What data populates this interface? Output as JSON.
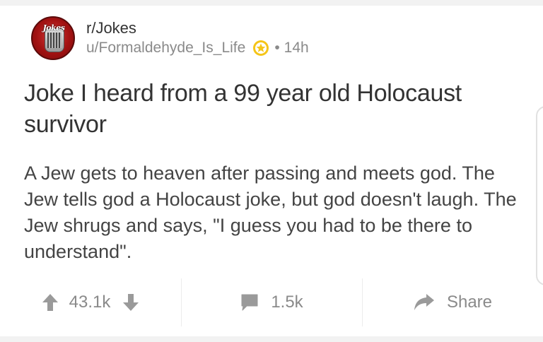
{
  "post": {
    "subreddit": "r/Jokes",
    "username": "u/Formaldehyde_Is_Life",
    "separator": "•",
    "age": "14h",
    "title": "Joke I heard from a 99 year old Holocaust survivor",
    "body": "A Jew gets to heaven after passing and meets god. The Jew tells god a Holocaust joke, but god doesn't laugh. The Jew shrugs and says, \"I guess you had to be there to understand\".",
    "avatar_logo_text": "Jokes"
  },
  "actions": {
    "upvotes": "43.1k",
    "comments": "1.5k",
    "share_label": "Share"
  },
  "icons": {
    "award": "award-badge-icon",
    "upvote": "arrow-up-icon",
    "downvote": "arrow-down-icon",
    "comment": "speech-bubble-icon",
    "share": "share-arrow-icon"
  },
  "colors": {
    "award_gold": "#f5c518",
    "icon_gray": "#9a9a9a",
    "title_text": "#333333",
    "meta_text": "#8a8a8a"
  }
}
